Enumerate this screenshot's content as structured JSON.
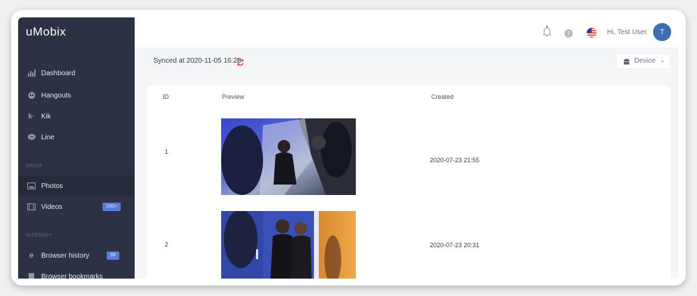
{
  "app": {
    "logo": "uMobix"
  },
  "sidebar": {
    "items": [
      {
        "label": "Dashboard",
        "icon": "bar-chart-icon"
      },
      {
        "label": "Hangouts",
        "icon": "hangouts-icon"
      },
      {
        "label": "Kik",
        "icon": "kik-icon"
      },
      {
        "label": "Line",
        "icon": "line-chat-icon"
      }
    ],
    "media_section": "MEDIA",
    "media_items": [
      {
        "label": "Photos",
        "icon": "photos-icon",
        "active": true
      },
      {
        "label": "Videos",
        "icon": "videos-icon",
        "badge": "100+"
      }
    ],
    "internet_section": "INTERNET",
    "internet_items": [
      {
        "label": "Browser history",
        "icon": "browser-icon",
        "badge": "58"
      },
      {
        "label": "Browser bookmarks",
        "icon": "bookmark-icon"
      }
    ]
  },
  "header": {
    "greeting": "Hi, Test User",
    "avatar_initial": "T"
  },
  "sync": {
    "text": "Synced at 2020-11-05 16:25"
  },
  "device": {
    "label": "Device"
  },
  "table": {
    "headers": [
      "ID",
      "Preview",
      "Created"
    ],
    "rows": [
      {
        "id": "1",
        "created": "2020-07-23 21:55"
      },
      {
        "id": "2",
        "created": "2020-07-23 20:31"
      }
    ]
  },
  "colors": {
    "sidebar": "#2c3243",
    "accent": "#5b7bd8",
    "avatar": "#3f6faf",
    "sync_icon": "#e0332b"
  }
}
